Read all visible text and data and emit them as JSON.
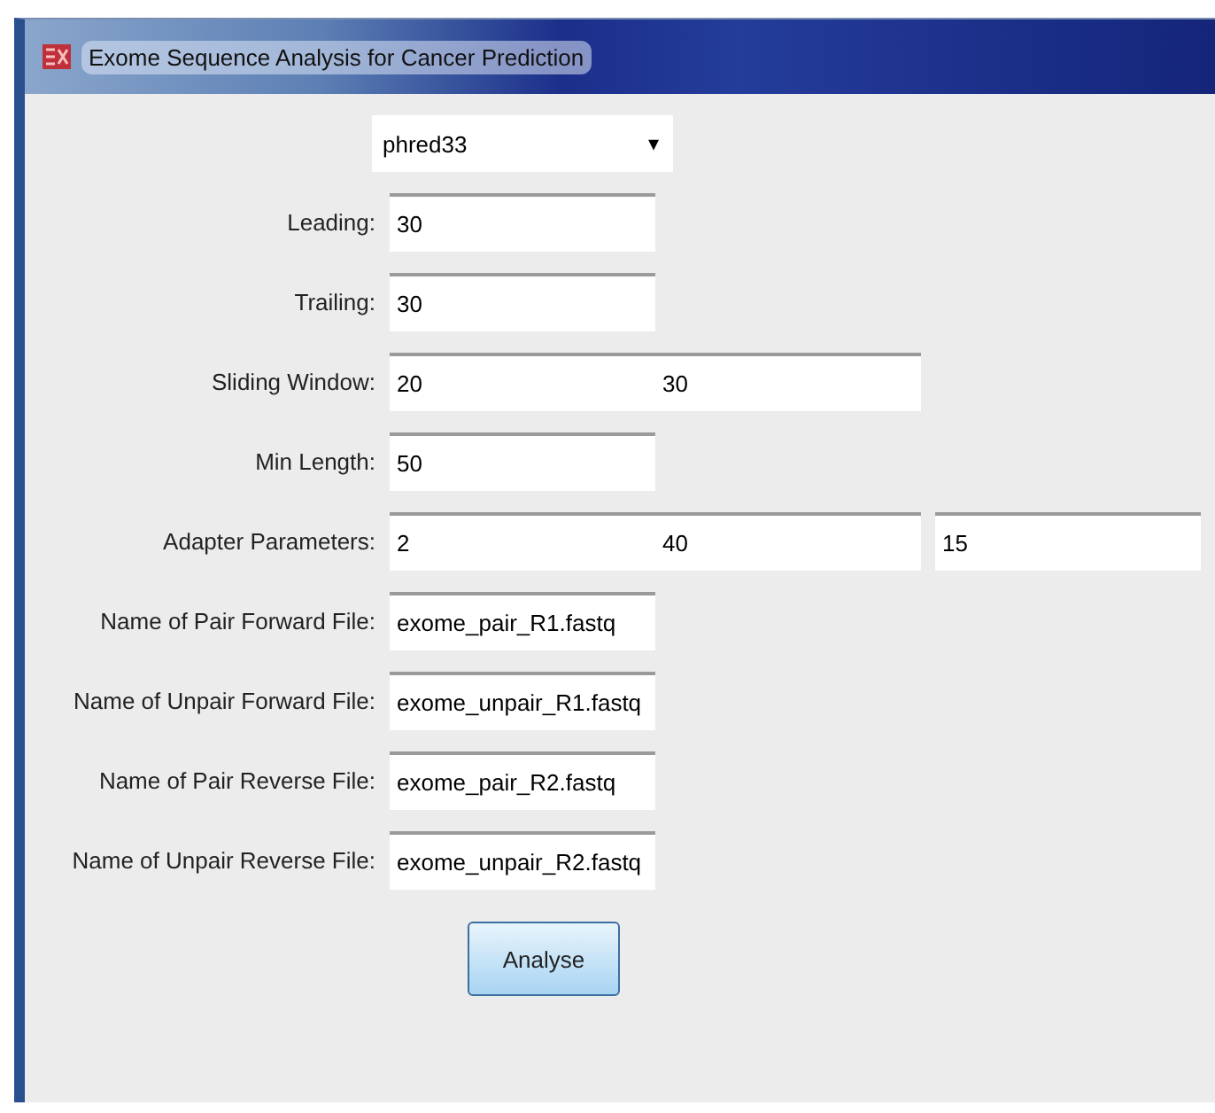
{
  "window": {
    "title": "Exome Sequence Analysis for Cancer Prediction"
  },
  "format_dropdown": {
    "value": "phred33",
    "arrow": "▾"
  },
  "rows": [
    {
      "label": "Leading:",
      "fields": [
        "30"
      ]
    },
    {
      "label": "Trailing:",
      "fields": [
        "30"
      ]
    },
    {
      "label": "Sliding Window:",
      "fields": [
        "20",
        "30"
      ]
    },
    {
      "label": "Min Length:",
      "fields": [
        "50"
      ]
    },
    {
      "label": "Adapter Parameters:",
      "fields": [
        "2",
        "40",
        "15"
      ]
    },
    {
      "label": "Name of Pair Forward File:",
      "fields": [
        "exome_pair_R1.fastq"
      ]
    },
    {
      "label": "Name of Unpair Forward File:",
      "fields": [
        "exome_unpair_R1.fastq"
      ]
    },
    {
      "label": "Name of Pair Reverse File:",
      "fields": [
        "exome_pair_R2.fastq"
      ]
    },
    {
      "label": "Name of Unpair Reverse File:",
      "fields": [
        "exome_unpair_R2.fastq"
      ]
    }
  ],
  "buttons": [
    "Analyse"
  ]
}
